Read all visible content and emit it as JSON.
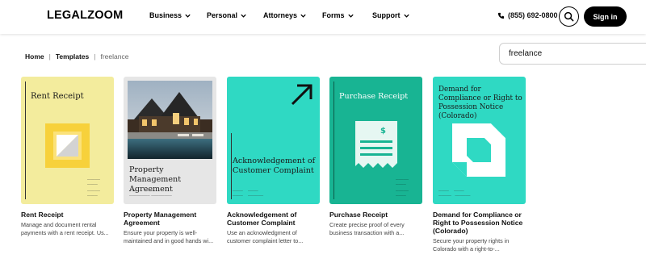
{
  "header": {
    "logo": {
      "main": "LEGAL",
      "accent": "ZOOM"
    },
    "nav": [
      {
        "label": "Business"
      },
      {
        "label": "Personal"
      },
      {
        "label": "Attorneys"
      },
      {
        "label": "Forms"
      },
      {
        "label": "Support"
      }
    ],
    "phone": "(855) 692-0800",
    "sign_in": "Sign in"
  },
  "breadcrumb": {
    "home": "Home",
    "templates": "Templates",
    "current": "freelance"
  },
  "search": {
    "value": "freelance"
  },
  "cards": [
    {
      "thumb_title": "Rent Receipt",
      "title": "Rent Receipt",
      "desc": "Manage and document rental payments with a rent receipt. Us..."
    },
    {
      "thumb_title": "Property Management Agreement",
      "title": "Property Management Agreement",
      "desc": "Ensure your property is well-maintained and in good hands wi..."
    },
    {
      "thumb_title": "Acknowledgement of Customer Complaint",
      "title": "Acknowledgement of Customer Complaint",
      "desc": "Use an acknowledgment of customer complaint letter to..."
    },
    {
      "thumb_title": "Purchase Receipt",
      "title": "Purchase Receipt",
      "desc": "Create precise proof of every business transaction with a..."
    },
    {
      "thumb_title": "Demand for Compliance or Right to Possession Notice (Colorado)",
      "title": "Demand for Compliance or Right to Possession Notice (Colorado)",
      "desc": "Secure your property rights in Colorado with a right-to-..."
    }
  ],
  "colors": {
    "yellow": "#f3ec9d",
    "teal": "#2fd9c3",
    "teal_dark": "#18b493",
    "gold": "#f7d13b"
  }
}
